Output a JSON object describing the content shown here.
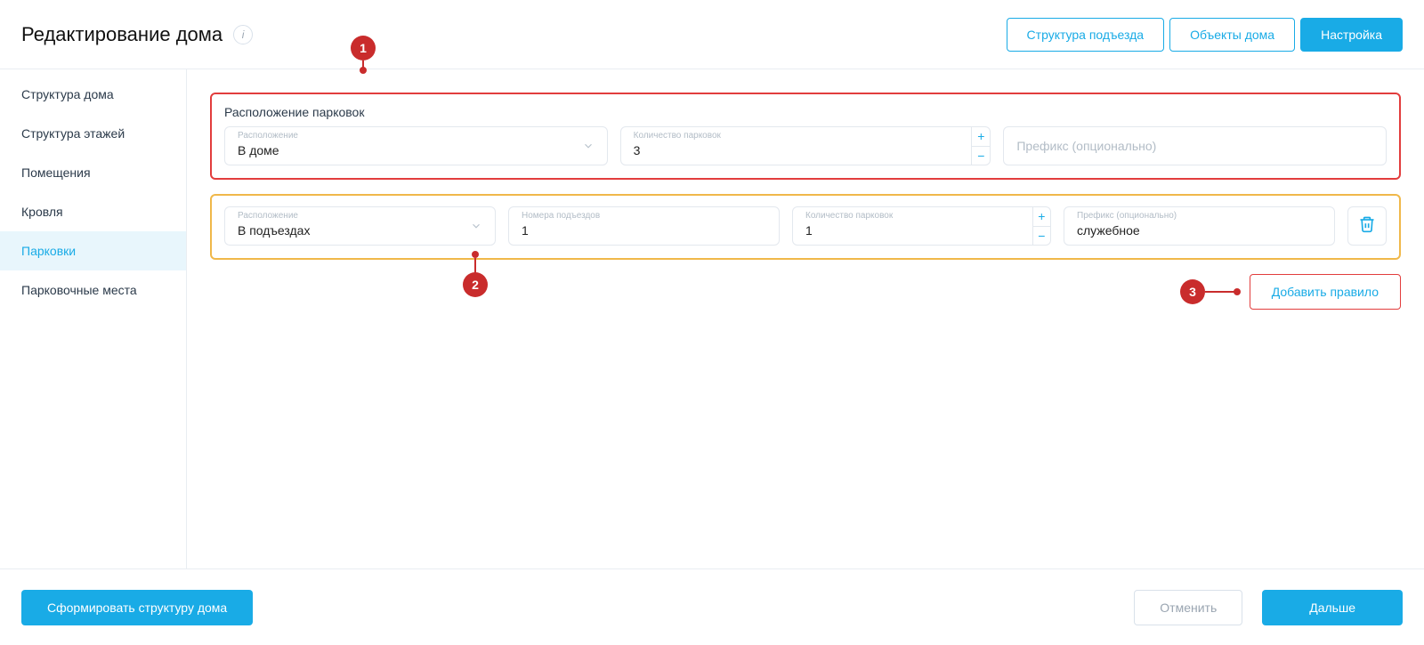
{
  "header": {
    "title": "Редактирование дома",
    "tabs": {
      "entrance": "Структура подъезда",
      "objects": "Объекты дома",
      "settings": "Настройка"
    }
  },
  "sidebar": {
    "items": [
      {
        "label": "Структура дома"
      },
      {
        "label": "Структура этажей"
      },
      {
        "label": "Помещения"
      },
      {
        "label": "Кровля"
      },
      {
        "label": "Парковки"
      },
      {
        "label": "Парковочные места"
      }
    ],
    "active_index": 4
  },
  "panels": {
    "red": {
      "title": "Расположение парковок",
      "location": {
        "label": "Расположение",
        "value": "В доме"
      },
      "count": {
        "label": "Количество парковок",
        "value": "3"
      },
      "prefix": {
        "placeholder": "Префикс (опционально)"
      }
    },
    "yellow": {
      "location": {
        "label": "Расположение",
        "value": "В подъездах"
      },
      "entrance_numbers": {
        "label": "Номера подъездов",
        "value": "1"
      },
      "count": {
        "label": "Количество парковок",
        "value": "1"
      },
      "prefix": {
        "label": "Префикс (опционально)",
        "value": "служебное"
      }
    }
  },
  "add_rule_label": "Добавить правило",
  "footer": {
    "build": "Сформировать структуру дома",
    "cancel": "Отменить",
    "next": "Дальше"
  },
  "callouts": {
    "one": "1",
    "two": "2",
    "three": "3"
  },
  "icons": {
    "plus": "+",
    "minus": "−",
    "info": "i"
  }
}
